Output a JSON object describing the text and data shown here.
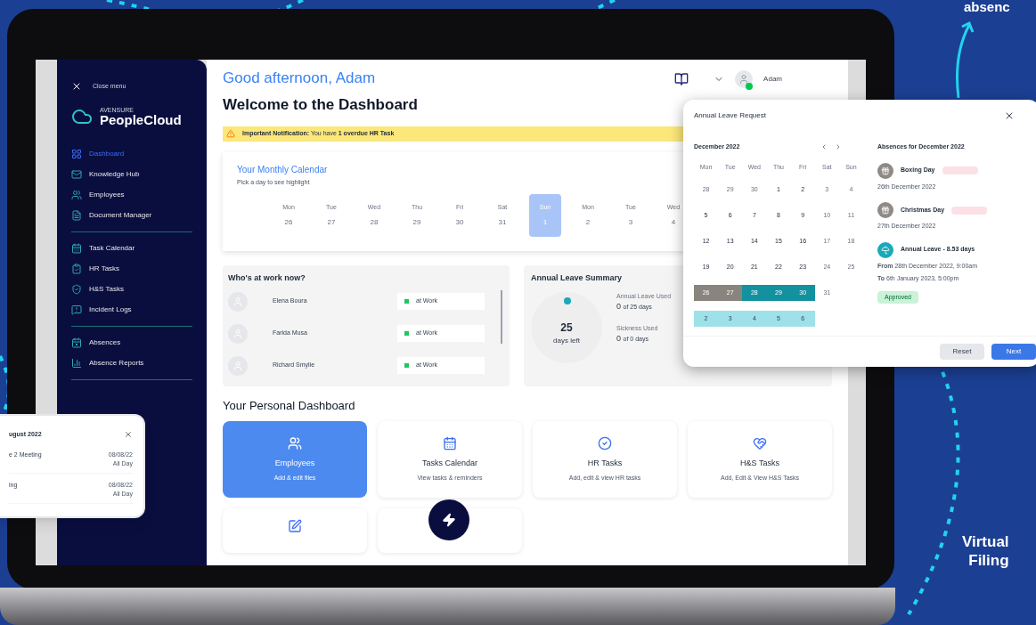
{
  "promo": {
    "top_caption": "absenc",
    "side_caption": [
      "Virtual",
      "Filing"
    ]
  },
  "sidebar": {
    "close_label": "Close menu",
    "logo": {
      "brand": "AVENSURE",
      "product": "PeopleCloud"
    },
    "sections": [
      [
        {
          "label": "Dashboard",
          "selected": true
        },
        {
          "label": "Knowledge Hub",
          "selected": false
        },
        {
          "label": "Employees",
          "selected": false
        },
        {
          "label": "Document Manager",
          "selected": false
        }
      ],
      [
        {
          "label": "Task Calendar",
          "selected": false
        },
        {
          "label": "HR Tasks",
          "selected": false
        },
        {
          "label": "H&S Tasks",
          "selected": false
        },
        {
          "label": "Incident Logs",
          "selected": false
        }
      ],
      [
        {
          "label": "Absences",
          "selected": false
        },
        {
          "label": "Absence Reports",
          "selected": false
        }
      ]
    ]
  },
  "header": {
    "greeting": "Good afternoon, Adam",
    "title": "Welcome to the Dashboard",
    "user": "Adam",
    "online": true
  },
  "notification": "**Important Notification:** You have **1 overdue HR Task**",
  "monthly_calendar": {
    "title": "Your Monthly Calendar",
    "subtitle": "Pick a day to see highlight",
    "days": [
      {
        "weekday": "Mon",
        "date": "26",
        "selected": false
      },
      {
        "weekday": "Tue",
        "date": "27",
        "selected": false
      },
      {
        "weekday": "Wed",
        "date": "28",
        "selected": false
      },
      {
        "weekday": "Thu",
        "date": "29",
        "selected": false
      },
      {
        "weekday": "Fri",
        "date": "30",
        "selected": false
      },
      {
        "weekday": "Sat",
        "date": "31",
        "selected": false
      },
      {
        "weekday": "Sun",
        "date": "1",
        "selected": true
      },
      {
        "weekday": "Mon",
        "date": "2",
        "selected": false
      },
      {
        "weekday": "Tue",
        "date": "3",
        "selected": false
      },
      {
        "weekday": "Wed",
        "date": "4",
        "selected": false
      }
    ]
  },
  "who_at_work": {
    "title": "Who's at work now?",
    "people": [
      {
        "name": "Elena Boura",
        "status": "at Work",
        "color": "#22c55e"
      },
      {
        "name": "Farida Musa",
        "status": "at Work",
        "color": "#22c55e"
      },
      {
        "name": "Richard Smylie",
        "status": "at Work",
        "color": "#22c55e"
      }
    ]
  },
  "leave_summary": {
    "title": "Annual Leave Summary",
    "days": "25",
    "days_caption": "days left",
    "stats": [
      {
        "label": "Annual Leave Used",
        "value": "0",
        "total": "of 25 days"
      },
      {
        "label": "Sickness Used",
        "value": "0",
        "total": "of 0 days"
      }
    ]
  },
  "personal_dashboard": {
    "title": "Your Personal Dashboard",
    "tiles": [
      {
        "title": "Employees",
        "subtitle": "Add & edit files",
        "selected": true
      },
      {
        "title": "Tasks Calendar",
        "subtitle": "View tasks & reminders",
        "selected": false
      },
      {
        "title": "HR Tasks",
        "subtitle": "Add, edit & view HR tasks",
        "selected": false
      },
      {
        "title": "H&S Tasks",
        "subtitle": "Add, Edit & View H&S Tasks",
        "selected": false
      }
    ]
  },
  "leave_modal": {
    "title": "Annual Leave Request",
    "month": "December 2022",
    "weekdays": [
      "Mon",
      "Tue",
      "Wed",
      "Thu",
      "Fri",
      "Sat",
      "Sun"
    ],
    "weeks": [
      [
        {
          "label": "28",
          "kind": "muted"
        },
        {
          "label": "29",
          "kind": "muted"
        },
        {
          "label": "30",
          "kind": "muted"
        },
        {
          "label": "1",
          "kind": "normal"
        },
        {
          "label": "2",
          "kind": "normal"
        },
        {
          "label": "3",
          "kind": "muted"
        },
        {
          "label": "4",
          "kind": "muted"
        }
      ],
      [
        {
          "label": "5",
          "kind": "normal"
        },
        {
          "label": "6",
          "kind": "normal"
        },
        {
          "label": "7",
          "kind": "normal"
        },
        {
          "label": "8",
          "kind": "normal"
        },
        {
          "label": "9",
          "kind": "normal"
        },
        {
          "label": "10",
          "kind": "muted"
        },
        {
          "label": "11",
          "kind": "muted"
        }
      ],
      [
        {
          "label": "12",
          "kind": "normal"
        },
        {
          "label": "13",
          "kind": "normal"
        },
        {
          "label": "14",
          "kind": "normal"
        },
        {
          "label": "15",
          "kind": "normal"
        },
        {
          "label": "16",
          "kind": "normal"
        },
        {
          "label": "17",
          "kind": "muted"
        },
        {
          "label": "18",
          "kind": "muted"
        }
      ],
      [
        {
          "label": "19",
          "kind": "normal"
        },
        {
          "label": "20",
          "kind": "normal"
        },
        {
          "label": "21",
          "kind": "normal"
        },
        {
          "label": "22",
          "kind": "normal"
        },
        {
          "label": "23",
          "kind": "normal"
        },
        {
          "label": "24",
          "kind": "muted"
        },
        {
          "label": "25",
          "kind": "muted"
        }
      ],
      [
        {
          "label": "26",
          "kind": "holiday"
        },
        {
          "label": "27",
          "kind": "holiday"
        },
        {
          "label": "28",
          "kind": "leave"
        },
        {
          "label": "29",
          "kind": "leave"
        },
        {
          "label": "30",
          "kind": "leave"
        },
        {
          "label": "31",
          "kind": "muted"
        }
      ],
      [
        {
          "label": "2",
          "kind": "pending"
        },
        {
          "label": "3",
          "kind": "pending"
        },
        {
          "label": "4",
          "kind": "pending"
        },
        {
          "label": "5",
          "kind": "pending"
        },
        {
          "label": "6",
          "kind": "pending"
        }
      ]
    ],
    "absences_title": "Absences for December 2022",
    "absences": [
      {
        "kind": "holiday",
        "title": "Boxing Day",
        "lines": [
          "26th December 2022"
        ]
      },
      {
        "kind": "holiday",
        "title": "Christmas Day",
        "lines": [
          "27th December 2022"
        ]
      },
      {
        "kind": "leave",
        "title": "Annual Leave - 8.53 days",
        "lines": [
          "**From** 28th December 2022, 9:00am",
          "**To** 6th January 2023, 5:00pm"
        ],
        "status": "Approved"
      }
    ],
    "buttons": [
      {
        "label": "Reset",
        "kind": "secondary"
      },
      {
        "label": "Next",
        "kind": "primary"
      }
    ]
  },
  "events_popup": {
    "title": "ugust 2022",
    "events": [
      {
        "name": "e 2 Meeting",
        "date": "08/08/22",
        "time": "All Day"
      },
      {
        "name": "ing",
        "date": "08/08/22",
        "time": "All Day"
      }
    ]
  }
}
